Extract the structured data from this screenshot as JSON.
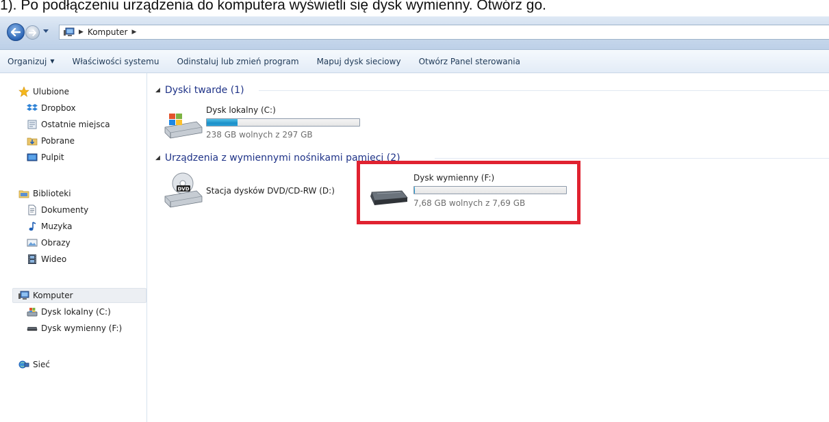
{
  "caption": "1). Po podłączeniu urządzenia do komputera wyświetli się dysk wymienny. Otwórz go.",
  "address": {
    "crumb": "Komputer",
    "computer_icon": "computer-icon"
  },
  "toolbar": {
    "organize": "Organizuj",
    "system_properties": "Właściwości systemu",
    "uninstall": "Odinstaluj lub zmień program",
    "map_drive": "Mapuj dysk sieciowy",
    "control_panel": "Otwórz Panel sterowania"
  },
  "sidebar": {
    "favorites": "Ulubione",
    "dropbox": "Dropbox",
    "recent": "Ostatnie miejsca",
    "downloads": "Pobrane",
    "desktop": "Pulpit",
    "libraries": "Biblioteki",
    "documents": "Dokumenty",
    "music": "Muzyka",
    "pictures": "Obrazy",
    "video": "Wideo",
    "computer": "Komputer",
    "drive_c": "Dysk lokalny (C:)",
    "drive_f": "Dysk wymienny (F:)",
    "network": "Sieć"
  },
  "groups": {
    "hard_disks": "Dyski twarde (1)",
    "removable": "Urządzenia z wymiennymi nośnikami pamięci (2)"
  },
  "drives": {
    "local_c": {
      "name": "Dysk lokalny (C:)",
      "free": "238 GB wolnych z 297 GB",
      "used_fraction": 0.2
    },
    "dvd_d": {
      "name": "Stacja dysków DVD/CD-RW (D:)",
      "badge": "DVD"
    },
    "removable_f": {
      "name": "Dysk wymienny (F:)",
      "free": "7,68 GB wolnych z 7,69 GB",
      "used_fraction": 0.0013
    }
  },
  "colors": {
    "highlight": "#e02230",
    "capacity_fill": "#1c8fc8",
    "group_header": "#1e3287"
  }
}
